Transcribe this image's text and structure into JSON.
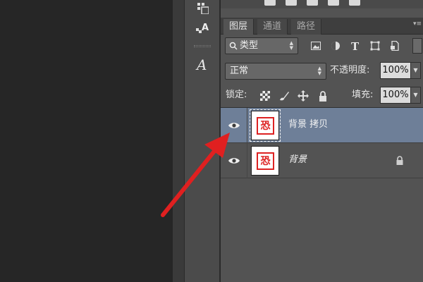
{
  "panel_tabs": {
    "layers": "图层",
    "channels": "通道",
    "paths": "路径"
  },
  "filter": {
    "kind_label": "类型"
  },
  "blend": {
    "mode": "正常",
    "opacity_label": "不透明度:",
    "opacity_value": "100%"
  },
  "lock_row": {
    "lock_label": "锁定:",
    "fill_label": "填充:",
    "fill_value": "100%"
  },
  "layers": [
    {
      "name": "背景 拷贝",
      "selected": true,
      "visible": true,
      "locked": false
    },
    {
      "name": "背景",
      "selected": false,
      "visible": true,
      "locked": true
    }
  ],
  "thumbnail_seal_text": "恐",
  "colors": {
    "selected_row": "#6e7f98",
    "annotation_arrow": "#e02020",
    "seal_red": "#dd2222"
  },
  "icons": [
    "channel-dots-icon",
    "type-glyph-icon",
    "script-a-icon",
    "image-filter-icon",
    "adjustment-filter-icon",
    "text-filter-icon",
    "shape-filter-icon",
    "smartobject-filter-icon",
    "eye-icon",
    "lock-icon"
  ]
}
